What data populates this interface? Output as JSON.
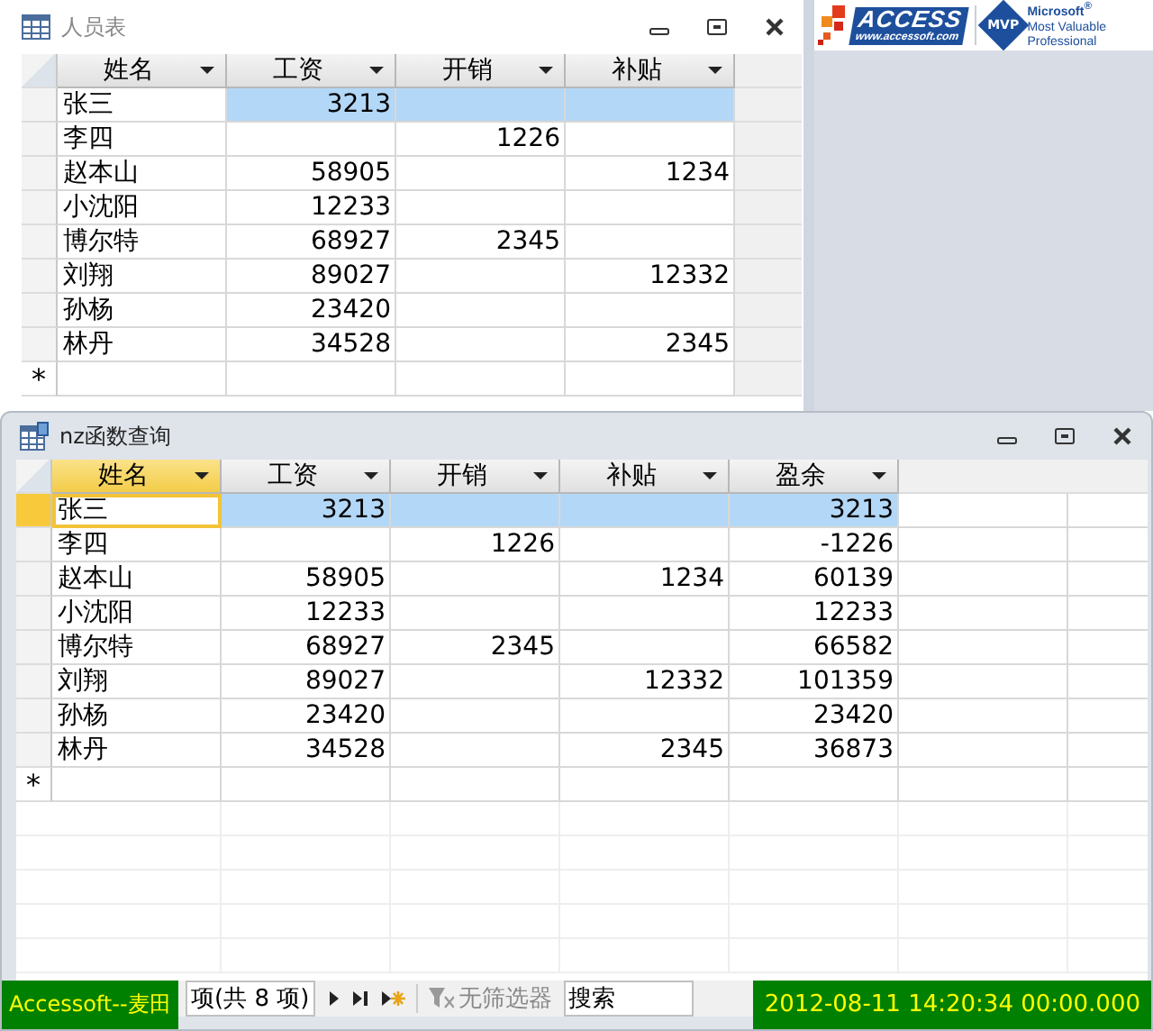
{
  "windows": [
    {
      "title": "人员表",
      "active": false,
      "columns": [
        {
          "label": "姓名",
          "selected": false
        },
        {
          "label": "工资",
          "selected": false
        },
        {
          "label": "开销",
          "selected": false
        },
        {
          "label": "补贴",
          "selected": false
        }
      ],
      "rows": [
        {
          "cells": [
            "张三",
            "3213",
            null,
            null
          ],
          "selected": true
        },
        {
          "cells": [
            "李四",
            null,
            "1226",
            null
          ],
          "selected": false
        },
        {
          "cells": [
            "赵本山",
            "58905",
            null,
            "1234"
          ],
          "selected": false
        },
        {
          "cells": [
            "小沈阳",
            "12233",
            null,
            null
          ],
          "selected": false
        },
        {
          "cells": [
            "博尔特",
            "68927",
            "2345",
            null
          ],
          "selected": false
        },
        {
          "cells": [
            "刘翔",
            "89027",
            null,
            "12332"
          ],
          "selected": false
        },
        {
          "cells": [
            "孙杨",
            "23420",
            null,
            null
          ],
          "selected": false
        },
        {
          "cells": [
            "林丹",
            "34528",
            null,
            "2345"
          ],
          "selected": false
        }
      ],
      "new_row_marker": "*"
    },
    {
      "title": "nz函数查询",
      "active": true,
      "columns": [
        {
          "label": "姓名",
          "selected": true
        },
        {
          "label": "工资",
          "selected": false
        },
        {
          "label": "开销",
          "selected": false
        },
        {
          "label": "补贴",
          "selected": false
        },
        {
          "label": "盈余",
          "selected": false
        }
      ],
      "rows": [
        {
          "cells": [
            "张三",
            "3213",
            null,
            null,
            "3213"
          ],
          "selected": true
        },
        {
          "cells": [
            "李四",
            null,
            "1226",
            null,
            "-1226"
          ],
          "selected": false
        },
        {
          "cells": [
            "赵本山",
            "58905",
            null,
            "1234",
            "60139"
          ],
          "selected": false
        },
        {
          "cells": [
            "小沈阳",
            "12233",
            null,
            null,
            "12233"
          ],
          "selected": false
        },
        {
          "cells": [
            "博尔特",
            "68927",
            "2345",
            null,
            "66582"
          ],
          "selected": false
        },
        {
          "cells": [
            "刘翔",
            "89027",
            null,
            "12332",
            "101359"
          ],
          "selected": false
        },
        {
          "cells": [
            "孙杨",
            "23420",
            null,
            null,
            "23420"
          ],
          "selected": false
        },
        {
          "cells": [
            "林丹",
            "34528",
            null,
            "2345",
            "36873"
          ],
          "selected": false
        }
      ],
      "new_row_marker": "*"
    }
  ],
  "logo": {
    "brand": "ACCESS",
    "url": "www.accessoft.com",
    "badge": "MVP",
    "mvp_lines": [
      "Microsoft$^{®}$",
      "Most Valuable",
      "Professional"
    ]
  },
  "navigation": {
    "record_text": "项(共 8 项)",
    "filter": "无筛选器",
    "search": "搜索"
  },
  "status_bar": {
    "left": "Accessoft--麦田",
    "right": "2012-08-11 14:20:34 00:00.000"
  }
}
